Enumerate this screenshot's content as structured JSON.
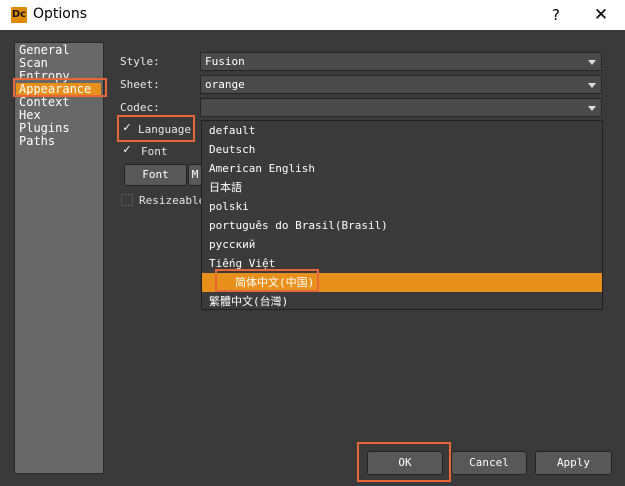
{
  "window": {
    "title": "Options",
    "app_icon": "Dc",
    "help": "?",
    "close": "✕"
  },
  "sidebar": {
    "items": [
      {
        "label": "General"
      },
      {
        "label": "Scan"
      },
      {
        "label": "Entropy"
      },
      {
        "label": "Appearance"
      },
      {
        "label": "Context"
      },
      {
        "label": "Hex"
      },
      {
        "label": "Plugins"
      },
      {
        "label": "Paths"
      }
    ],
    "selected": "Appearance"
  },
  "form": {
    "style": {
      "label": "Style:",
      "value": "Fusion"
    },
    "sheet": {
      "label": "Sheet:",
      "value": "orange"
    },
    "codec": {
      "label": "Codec:",
      "value": ""
    },
    "language": {
      "label": "Language:",
      "checked": true
    },
    "font_check": {
      "label": "Font",
      "checked": true
    },
    "font_button": "Font",
    "mono_button": "M",
    "resizeable": {
      "label": "Resizeable",
      "checked": false
    }
  },
  "language_options": [
    "default",
    "Deutsch",
    "American English",
    "日本語",
    "polski",
    "português do Brasil(Brasil)",
    "русский",
    "Tiếng Việt",
    "简体中文(中国)",
    "繁體中文(台灣)"
  ],
  "language_selected": "简体中文(中国)",
  "buttons": {
    "ok": "OK",
    "cancel": "Cancel",
    "apply": "Apply"
  },
  "colors": {
    "accent": "#e8901c",
    "annotation": "#e9663a",
    "panel": "#3a3a3a"
  }
}
